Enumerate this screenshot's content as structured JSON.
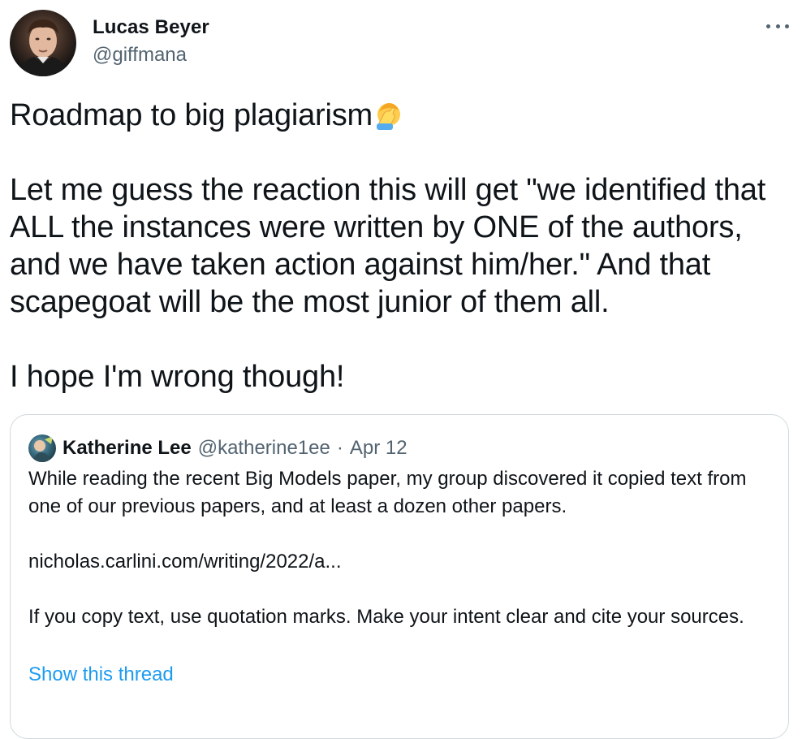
{
  "author": {
    "display_name": "Lucas Beyer",
    "handle": "@giffmana"
  },
  "tweet": {
    "text": "Roadmap to big plagiarism",
    "emoji": "face-palm-emoji",
    "paragraph_2": "Let me guess the reaction this will get \"we identified that ALL the instances were written by ONE of the authors, and we have taken action against him/her.\" And that scapegoat will be the most junior of them all.",
    "paragraph_3": "I hope I'm wrong though!"
  },
  "quoted_tweet": {
    "display_name": "Katherine Lee",
    "handle": "@katherine1ee",
    "separator": "·",
    "date": "Apr 12",
    "body": "While reading the recent Big Models paper, my group discovered it copied text from one of our previous papers, and at least a dozen other papers.\n\nnicholas.carlini.com/writing/2022/a...\n\nIf you copy text, use quotation marks. Make your intent clear and cite your sources.",
    "show_thread_label": "Show this thread"
  },
  "colors": {
    "text": "#0f1419",
    "secondary": "#536471",
    "link": "#1d9bf0",
    "border": "#cfd9de"
  }
}
